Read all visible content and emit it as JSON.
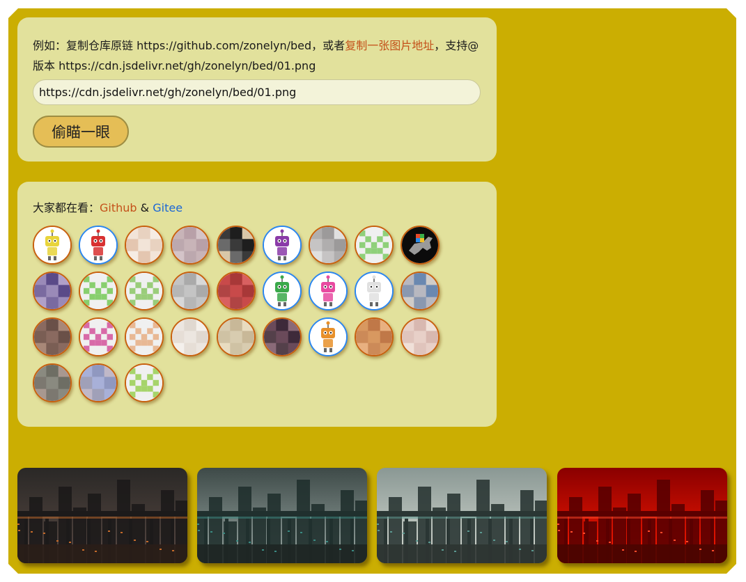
{
  "intro": {
    "prefix": "例如：复制仓库原链 https://github.com/zonelyn/bed，或者",
    "link": "复制一张图片地址",
    "suffix": "，支持@版本 https://cdn.jsdelivr.net/gh/zonelyn/bed/01.png"
  },
  "url_input": {
    "value": "https://cdn.jsdelivr.net/gh/zonelyn/bed/01.png"
  },
  "peek_button": {
    "label": "偷瞄一眼"
  },
  "watching": {
    "label": "大家都在看：",
    "github": "Github",
    "amp": " & ",
    "gitee": "Gitee"
  },
  "avatars": [
    {
      "ring": "orange",
      "kind": "robot-yellow"
    },
    {
      "ring": "blue",
      "kind": "robot-red"
    },
    {
      "ring": "orange",
      "kind": "pixel-peach"
    },
    {
      "ring": "orange",
      "kind": "pixel-mauve"
    },
    {
      "ring": "orange",
      "kind": "pixel-dark"
    },
    {
      "ring": "blue",
      "kind": "robot-purple"
    },
    {
      "ring": "orange",
      "kind": "pixel-gray"
    },
    {
      "ring": "orange",
      "kind": "identicon-green"
    },
    {
      "ring": "orange",
      "kind": "dino-photo"
    },
    {
      "ring": "orange",
      "kind": "pixel-violet"
    },
    {
      "ring": "orange",
      "kind": "identicon-green-2"
    },
    {
      "ring": "orange",
      "kind": "identicon-green-3"
    },
    {
      "ring": "orange",
      "kind": "pixel-silver"
    },
    {
      "ring": "orange",
      "kind": "pixel-red"
    },
    {
      "ring": "blue",
      "kind": "robot-green"
    },
    {
      "ring": "blue",
      "kind": "robot-pink"
    },
    {
      "ring": "blue",
      "kind": "robot-white"
    },
    {
      "ring": "orange",
      "kind": "pixel-blue"
    },
    {
      "ring": "orange",
      "kind": "pixel-brown"
    },
    {
      "ring": "orange",
      "kind": "identicon-pink"
    },
    {
      "ring": "orange",
      "kind": "identicon-tan"
    },
    {
      "ring": "orange",
      "kind": "pixel-light"
    },
    {
      "ring": "orange",
      "kind": "pixel-beige"
    },
    {
      "ring": "orange",
      "kind": "pixel-plum"
    },
    {
      "ring": "blue",
      "kind": "robot-orange"
    },
    {
      "ring": "orange",
      "kind": "pixel-tan"
    },
    {
      "ring": "orange",
      "kind": "pixel-rose"
    },
    {
      "ring": "orange",
      "kind": "pixel-olive"
    },
    {
      "ring": "orange",
      "kind": "pixel-lavender"
    },
    {
      "ring": "orange",
      "kind": "identicon-lime"
    }
  ],
  "thumbnails": [
    {
      "name": "city-night-bridge"
    },
    {
      "name": "city-teal-overpass"
    },
    {
      "name": "city-daylight-street"
    },
    {
      "name": "city-red-tint"
    }
  ],
  "colors": {
    "frame": "#cbae02",
    "card": "#e2e19c",
    "button": "#e5be56",
    "link_orange": "#c4511a",
    "link_blue": "#1a66d6"
  }
}
